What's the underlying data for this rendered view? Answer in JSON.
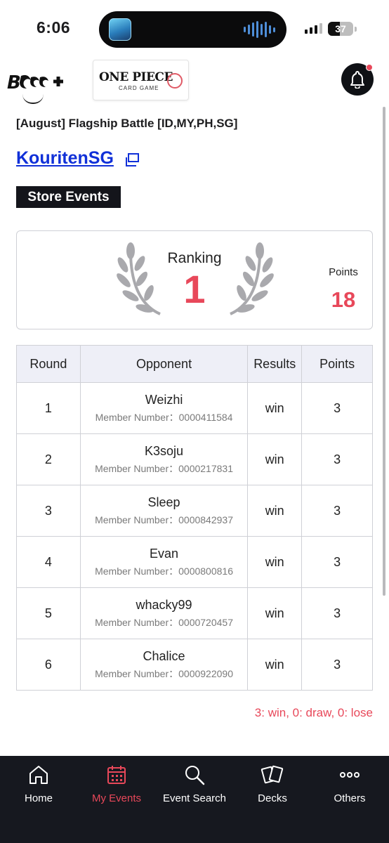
{
  "status_bar": {
    "time": "6:06",
    "battery": "37"
  },
  "header": {
    "brand_logo_text": "B CG+",
    "card_game_logo": {
      "title": "ONE PIECE",
      "subtitle": "CARD GAME"
    }
  },
  "event": {
    "title": "[August] Flagship Battle [ID,MY,PH,SG]",
    "store_name": "KouritenSG",
    "tag": "Store Events"
  },
  "ranking": {
    "label": "Ranking",
    "value": "1",
    "points_label": "Points",
    "points_value": "18"
  },
  "results": {
    "headers": [
      "Round",
      "Opponent",
      "Results",
      "Points"
    ],
    "member_prefix": "Member Number：",
    "rows": [
      {
        "round": "1",
        "name": "Weizhi",
        "member": "Member Number：0000411584",
        "result": "win",
        "points": "3"
      },
      {
        "round": "2",
        "name": "K3soju",
        "member": "Member Number：0000217831",
        "result": "win",
        "points": "3"
      },
      {
        "round": "3",
        "name": "Sleep",
        "member": "Member Number：0000842937",
        "result": "win",
        "points": "3"
      },
      {
        "round": "4",
        "name": "Evan",
        "member": "Member Number：0000800816",
        "result": "win",
        "points": "3"
      },
      {
        "round": "5",
        "name": "whacky99",
        "member": "Member Number：0000720457",
        "result": "win",
        "points": "3"
      },
      {
        "round": "6",
        "name": "Chalice",
        "member": "Member Number：0000922090",
        "result": "win",
        "points": "3"
      }
    ],
    "legend": "3: win, 0: draw, 0: lose"
  },
  "bottom_nav": [
    {
      "label": "Home",
      "icon": "home-icon",
      "active": false
    },
    {
      "label": "My Events",
      "icon": "calendar-icon",
      "active": true
    },
    {
      "label": "Event Search",
      "icon": "search-icon",
      "active": false
    },
    {
      "label": "Decks",
      "icon": "cards-icon",
      "active": false
    },
    {
      "label": "Others",
      "icon": "more-icon",
      "active": false
    }
  ],
  "colors": {
    "accent": "#e8485a",
    "link": "#1030d8",
    "nav_bg": "#16181f",
    "table_header_bg": "#eeeff7"
  }
}
